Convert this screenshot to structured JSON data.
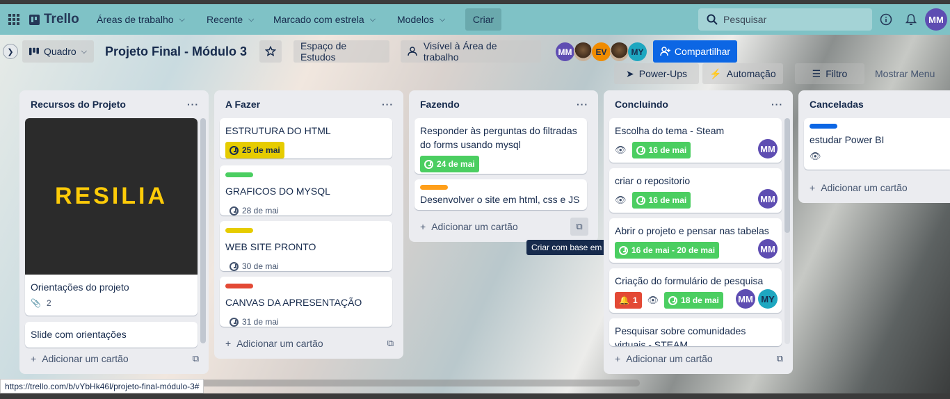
{
  "topbar": {
    "logo": "Trello",
    "menus": [
      {
        "label": "Áreas de trabalho"
      },
      {
        "label": "Recente"
      },
      {
        "label": "Marcado com estrela"
      },
      {
        "label": "Modelos"
      }
    ],
    "create_label": "Criar",
    "search_placeholder": "Pesquisar",
    "user_initials": "MM"
  },
  "board": {
    "view_label": "Quadro",
    "title": "Projeto Final - Módulo 3",
    "workspace": "Espaço de Estudos",
    "visibility": "Visível à Área de trabalho",
    "members": [
      {
        "initials": "MM"
      },
      {
        "initials": ""
      },
      {
        "initials": "EV"
      },
      {
        "initials": ""
      },
      {
        "initials": "MY"
      }
    ],
    "share_label": "Compartilhar",
    "powerups_label": "Power-Ups",
    "automation_label": "Automação",
    "filter_label": "Filtro",
    "menu_label": "Mostrar Menu"
  },
  "lists": [
    {
      "title": "Recursos do Projeto",
      "add_label": "Adicionar um cartão",
      "cards": [
        {
          "cover_text": "RESILIA",
          "title": "Orientações do projeto",
          "attachments": "2"
        },
        {
          "title": "Slide com orientações"
        }
      ]
    },
    {
      "title": "A Fazer",
      "add_label": "Adicionar um cartão",
      "cards": [
        {
          "title": "ESTRUTURA DO HTML",
          "due": "25 de mai"
        },
        {
          "title": "GRAFICOS DO MYSQL",
          "due": "28 de mai"
        },
        {
          "title": "WEB SITE PRONTO",
          "due": "30 de mai"
        },
        {
          "title": "CANVAS DA APRESENTAÇÃO",
          "due": "31 de mai"
        }
      ]
    },
    {
      "title": "Fazendo",
      "add_label": "Adicionar um cartão",
      "cards": [
        {
          "title": "Responder às perguntas do filtradas do forms usando mysql",
          "due": "24 de mai"
        },
        {
          "title": "Desenvolver o site em html, css e JS"
        }
      ]
    },
    {
      "title": "Concluindo",
      "add_label": "Adicionar um cartão",
      "cards": [
        {
          "title": "Escolha do tema - Steam",
          "due": "16 de mai",
          "member": "MM"
        },
        {
          "title": "criar o repositorio",
          "due": "16 de mai",
          "member": "MM"
        },
        {
          "title": "Abrir o projeto e pensar nas tabelas",
          "due": "16 de mai - 20 de mai",
          "member": "MM"
        },
        {
          "title": "Criação do formulário de pesquisa",
          "notifications": "1",
          "due": "18 de mai",
          "members": [
            "MM",
            "MY"
          ]
        },
        {
          "title": "Pesquisar sobre comunidades virtuais - STEAM"
        }
      ]
    },
    {
      "title": "Canceladas",
      "add_label": "Adicionar um cartão",
      "cards": [
        {
          "title": "estudar Power BI"
        }
      ]
    }
  ],
  "tooltip": "Criar com base em modelo...",
  "status_url": "https://trello.com/b/vYbHk46l/projeto-final-módulo-3#",
  "colors": {
    "topbar": "#7fc2c6",
    "share": "#0c66e4",
    "green_due": "#4bce61",
    "yellow_due": "#e6cc00",
    "label_green": "#4bce61",
    "label_yellow": "#e6cc00",
    "label_red": "#e34935",
    "label_orange": "#ff9f1a",
    "label_blue": "#0c66e4",
    "cover_bg": "#2b2b2b",
    "cover_text": "#fdcb08"
  }
}
